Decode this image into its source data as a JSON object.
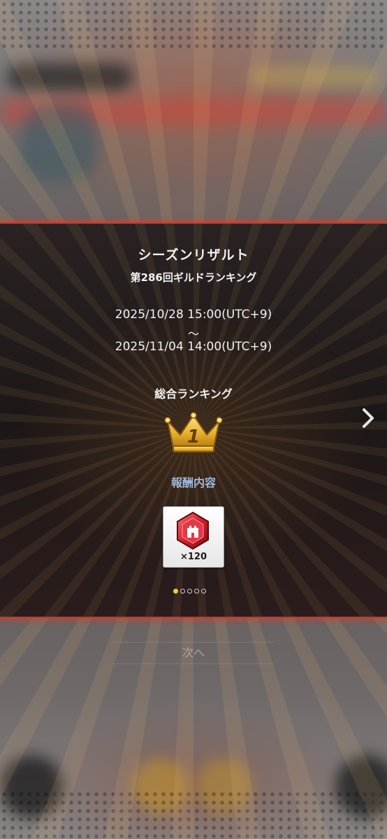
{
  "dialog": {
    "title": "シーズンリザルト",
    "ranking_name": "第286回ギルドランキング",
    "period_start": "2025/10/28 15:00(UTC+9)",
    "period_separator": "〜",
    "period_end": "2025/11/04 14:00(UTC+9)",
    "overall_label": "総合ランキング",
    "rank": "1",
    "reward_label": "報酬内容",
    "reward": {
      "icon": "red-castle-medal-icon",
      "count": "×120"
    },
    "pager": {
      "total": 5,
      "current": 1
    }
  },
  "footer": {
    "next_label": "次へ"
  },
  "colors": {
    "accent_red": "#c43a2a",
    "crown_gold": "#e8b030",
    "reward_red": "#d02030",
    "reward_title_blue": "#9fb8d8",
    "pager_active": "#e8d040"
  }
}
